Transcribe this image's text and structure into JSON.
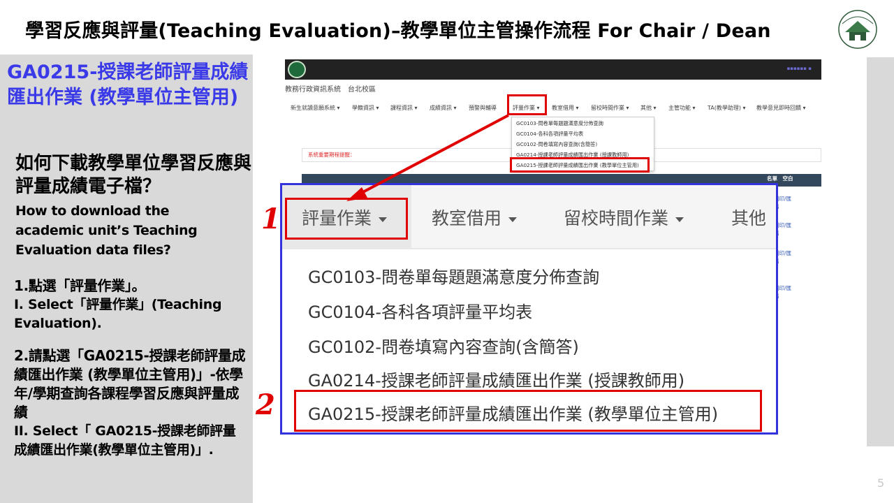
{
  "slide": {
    "title": "學習反應與評量(Teaching  Evaluation)–教學單位主管操作流程  For Chair / Dean",
    "page_number": "5"
  },
  "left": {
    "heading": "GA0215-授課老師評量成績匯出作業 (教學單位主管用)",
    "question_zh": "如何下載教學單位學習反應與評量成績電子檔？",
    "question_en": "How to download the academic unit’s Teaching Evaluation data files?",
    "step1_zh": "1.點選「評量作業」。",
    "step1_en": "I. Select「評量作業」(Teaching Evaluation).",
    "step2_zh": "2.請點選「GA0215-授課老師評量成績匯出作業 (教學單位主管用)」-依學年/學期查詢各課程學習反應與評量成績",
    "step2_en": "II. Select「 GA0215-授課老師評量成績匯出作業(教學單位主管用)」."
  },
  "system": {
    "name": "教務行政資訊系統　台北校區",
    "nav": [
      "新生就讀意願系統 ▾",
      "學籍資訊 ▾",
      "課程資訊 ▾",
      "成績資訊 ▾",
      "預警與輔導",
      "評量作業 ▾",
      "教室借用 ▾",
      "留校時間作業 ▾",
      "其他 ▾",
      "主管功能 ▾",
      "TA(教學助理) ▾",
      "教學意見即時回饋 ▾"
    ],
    "dropdown": [
      "GC0103-問卷單每題題滿意度分佈查詢",
      "GC0104-各科各項評量平均表",
      "GC0102-問卷填寫內容查詢(含簡答)",
      "GA0214-授課老師評量成績匯出作業 (授課教師用)",
      "GA0215-授課老師評量成績匯出作業 (教學單位主管用)"
    ],
    "reminder": "系統重要期程提醒：",
    "table_head": "名單　空白",
    "row_links": [
      "列印/匯出",
      "列印/匯出",
      "列印/匯出",
      "列印/匯出"
    ]
  },
  "zoom": {
    "menu": [
      "評量作業",
      "教室借用",
      "留校時間作業",
      "其他"
    ],
    "items": [
      "GC0103-問卷單每題題滿意度分佈查詢",
      "GC0104-各科各項評量平均表",
      "GC0102-問卷填寫內容查詢(含簡答)",
      "GA0214-授課老師評量成績匯出作業 (授課教師用)",
      "GA0215-授課老師評量成績匯出作業 (教學單位主管用)"
    ]
  },
  "markers": {
    "one": "1",
    "two": "2"
  },
  "colors": {
    "heading_blue": "#3a3ae8",
    "highlight_red": "#e00000",
    "zoom_border": "#3333dd",
    "panel_gray": "#d9d9d9"
  }
}
